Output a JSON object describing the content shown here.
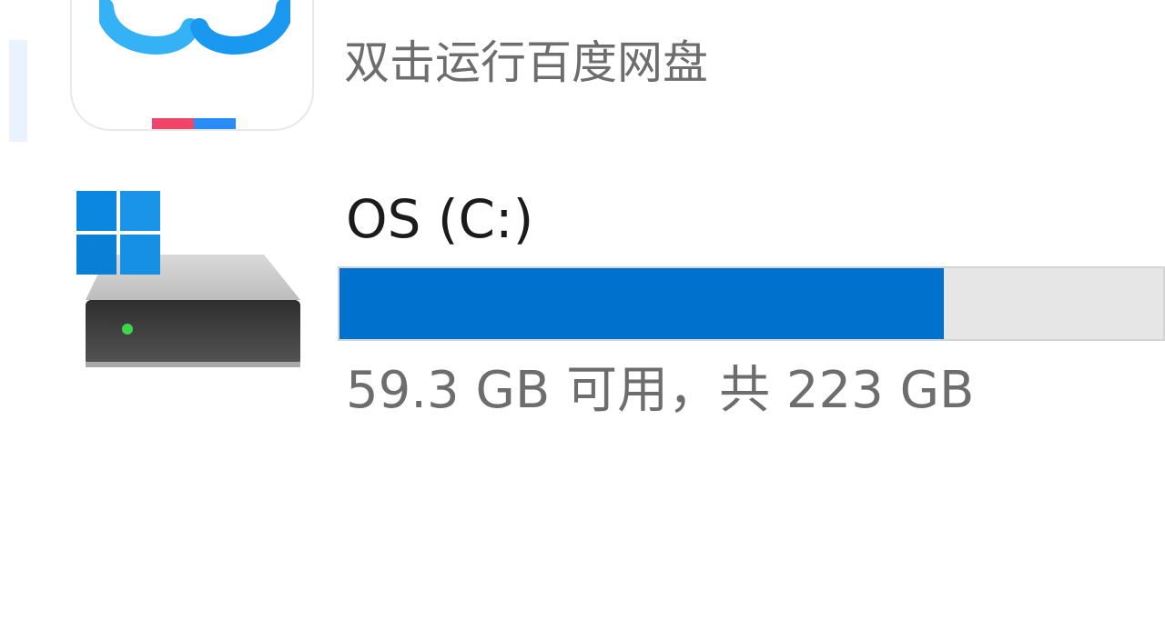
{
  "items": [
    {
      "kind": "app-shortcut",
      "description": "双击运行百度网盘",
      "icon": "baidu-netdisk-icon",
      "selected": true
    },
    {
      "kind": "drive",
      "name": "OS (C:)",
      "icon": "windows-system-drive-icon",
      "free_space": "59.3 GB",
      "total_space": "223 GB",
      "usage_text": "59.3 GB 可用，共 223 GB",
      "used_fraction": 0.734
    }
  ],
  "colors": {
    "usage_fill": "#0071cd",
    "usage_track": "#e6e6e6",
    "selection": "#e9f2fd",
    "secondary_text": "#6d6d6d",
    "primary_text": "#1b1b1b",
    "windows_blue": "#0b87e0",
    "brand_red": "#f0456a",
    "brand_blue": "#2a8cf5"
  }
}
